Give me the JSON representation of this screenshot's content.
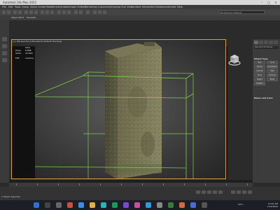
{
  "window": {
    "title": "Autodesk 3ds Max 2022"
  },
  "menu": [
    "File",
    "Edit",
    "Tools",
    "Group",
    "Views",
    "Create",
    "Modifiers",
    "Animation",
    "Graph Editors",
    "Rendering",
    "Customize",
    "Scripting",
    "Civil View",
    "Content",
    "Interactive",
    "Substance",
    "Arnold",
    "Help"
  ],
  "toolbar": {
    "workspace": "Workspaces: Default",
    "tabs": [
      "Object Paint",
      "Populate"
    ]
  },
  "viewport": {
    "label": "[+] [Perspective] [Standard] [Default Shading]",
    "stats": {
      "total_label": "Total",
      "polys_label": "Polys:",
      "polys_value": "8,888",
      "verts_label": "Verts:",
      "verts_value": "10,000",
      "fps_label": "FPS:",
      "fps_value": "Inactive"
    },
    "selection_color": "#7fd041",
    "active_border_color": "#d6a13a"
  },
  "command_panel": {
    "category": "Standard Primitives",
    "object_type_title": "Object Type",
    "object_types": [
      "Box",
      "Cone",
      "Sphere",
      "GeoSphere",
      "Cylinder",
      "Tube",
      "Torus",
      "Pyramid",
      "Teapot",
      "Plane",
      "TextPlus"
    ],
    "name_color_title": "Name and Color"
  },
  "status": {
    "message": "1 Object Selected"
  },
  "taskbar": {
    "temperature": "29°C",
    "time": "10:42 AM",
    "date": "7/12/2022"
  },
  "icons": [
    "minimize-icon",
    "maximize-icon",
    "close-icon",
    "viewcube-icon",
    "windows-start-icon",
    "search-icon"
  ]
}
